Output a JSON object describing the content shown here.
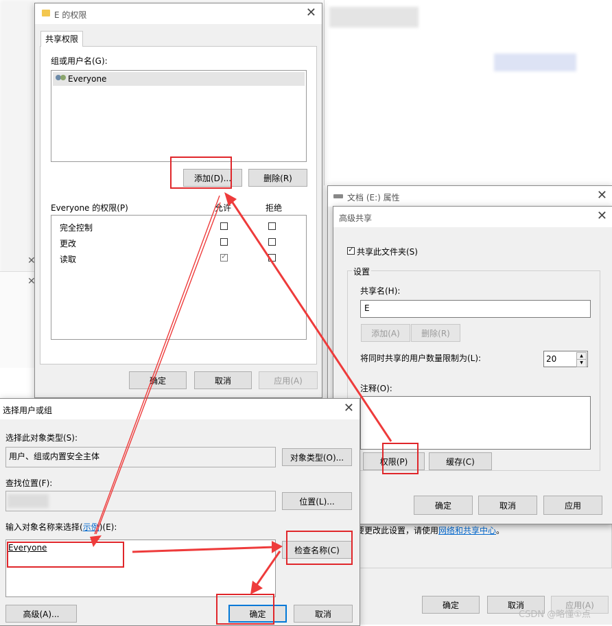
{
  "background": {
    "behind_bottom": {
      "note_prefix": "要更改此设置，请使用",
      "note_link": "网络和共享中心",
      "note_suffix": "。",
      "ok": "确定",
      "cancel": "取消",
      "apply": "应用(A)"
    }
  },
  "perm_dialog": {
    "title": "E 的权限",
    "tab": "共享权限",
    "group_label": "组或用户名(G):",
    "users": [
      "Everyone"
    ],
    "add": "添加(D)...",
    "remove": "删除(R)",
    "perm_label": "Everyone 的权限(P)",
    "allow": "允许",
    "deny": "拒绝",
    "perms": [
      {
        "name": "完全控制",
        "allow": false,
        "deny": false
      },
      {
        "name": "更改",
        "allow": false,
        "deny": false
      },
      {
        "name": "读取",
        "allow": true,
        "deny": false
      }
    ],
    "ok": "确定",
    "cancel": "取消",
    "apply": "应用(A)"
  },
  "props_dialog": {
    "title": "文档 (E:) 属性"
  },
  "adv_share": {
    "title": "高级共享",
    "share_check": "共享此文件夹(S)",
    "share_checked": true,
    "settings": "设置",
    "share_name_label": "共享名(H):",
    "share_name": "E",
    "add": "添加(A)",
    "remove": "删除(R)",
    "limit_label": "将同时共享的用户数量限制为(L):",
    "limit": "20",
    "comment_label": "注释(O):",
    "permissions": "权限(P)",
    "caching": "缓存(C)",
    "ok": "确定",
    "cancel": "取消",
    "apply": "应用"
  },
  "select_dialog": {
    "title": "选择用户或组",
    "type_label": "选择此对象类型(S):",
    "type_value": "用户、组或内置安全主体",
    "type_btn": "对象类型(O)...",
    "loc_label": "查找位置(F):",
    "loc_btn": "位置(L)...",
    "enter_prefix": "输入对象名称来选择(",
    "enter_link": "示例",
    "enter_suffix": ")(E):",
    "entered": "Everyone",
    "check_btn": "检查名称(C)",
    "advanced": "高级(A)...",
    "ok": "确定",
    "cancel": "取消"
  },
  "watermark": "CSDN @略懂①点",
  "colors": {
    "annotation": "#e0262a",
    "link": "#0066cc",
    "focus": "#0078d7"
  }
}
